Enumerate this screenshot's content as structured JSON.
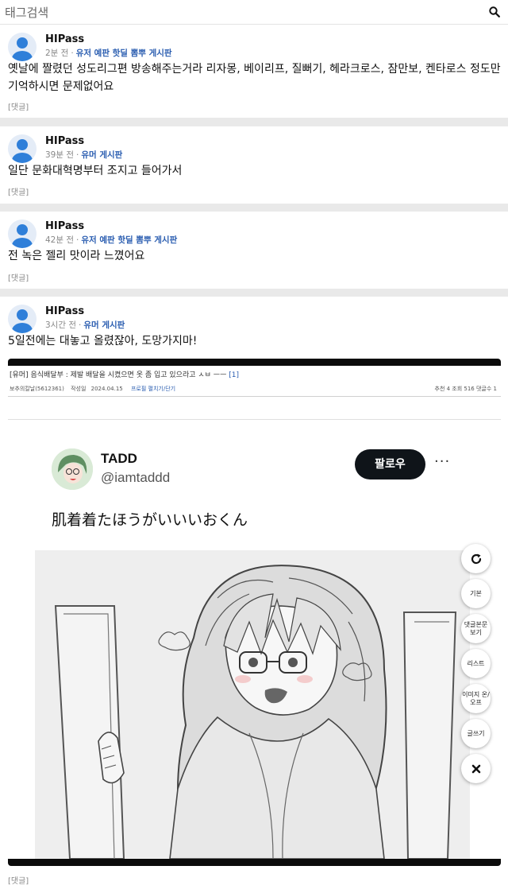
{
  "search": {
    "placeholder": "태그검색",
    "icon": "search-icon"
  },
  "posts": [
    {
      "user": "HIPass",
      "time": "2분 전",
      "board": "유저 예판 핫딜 뽐뿌 게시판",
      "body": "옛날에 짤렸던 성도리그편 방송해주는거라 리자몽, 베이리프, 질뻐기, 헤라크로스, 잠만보, 켄타로스 정도만 기억하시면 문제없어요",
      "reply": "[댓글]"
    },
    {
      "user": "HIPass",
      "time": "39분 전",
      "board": "유머 게시판",
      "body": "일단 문화대혁명부터 조지고 들어가서",
      "reply": "[댓글]"
    },
    {
      "user": "HIPass",
      "time": "42분 전",
      "board": "유저 예판 핫딜 뽐뿌 게시판",
      "body": "전 녹은 젤리 맛이라 느꼈어요",
      "reply": "[댓글]"
    },
    {
      "user": "HIPass",
      "time": "3시간 전",
      "board": "유머 게시판",
      "body": "5일전에는 대놓고 올렸잖아, 도망가지마!",
      "reply": "[댓글]"
    }
  ],
  "capture": {
    "title": "[유머] 음식배달부 : 제발 배달을 시켰으면 옷 좀 입고 있으라고 ㅅㅂ ㅡㅡ",
    "title_count": "[1]",
    "meta_author": "보추의칼날(5612361)",
    "meta_label": "작성일",
    "meta_date": "2024.04.15",
    "meta_link": "프로필 펼치기/단기",
    "meta_stats": "추천 4   조회 516   댓글수 1",
    "tweet": {
      "name": "TADD",
      "handle": "@iamtaddd",
      "follow_label": "팔로우",
      "more": "···",
      "text": "肌着着たほうがいいいおくん"
    }
  },
  "floating_buttons": [
    {
      "label": "",
      "icon": "refresh-icon"
    },
    {
      "label": "기본"
    },
    {
      "label": "댓글본문 보기"
    },
    {
      "label": "리스트"
    },
    {
      "label": "이미지 온/오프"
    },
    {
      "label": "글쓰기"
    },
    {
      "label": "",
      "icon": "close-icon"
    }
  ],
  "colors": {
    "board_link": "#2a5db0",
    "avatar": "#2f7fd9",
    "follow_bg": "#0f1419"
  }
}
